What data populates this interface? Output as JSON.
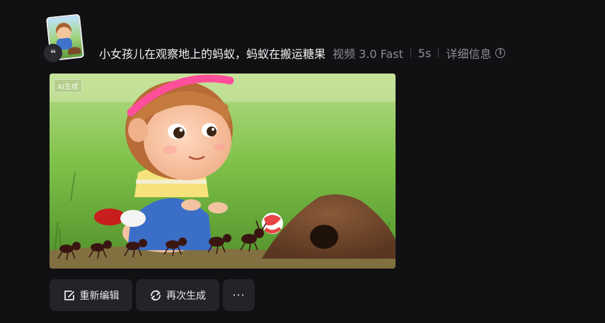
{
  "generation": {
    "prompt": "小女孩儿在观察地上的蚂蚁，蚂蚁在搬运糖果",
    "model": "视频 3.0 Fast",
    "duration": "5s",
    "details_label": "详细信息"
  },
  "video": {
    "ai_badge": "AI生成"
  },
  "actions": {
    "edit_label": "重新编辑",
    "regenerate_label": "再次生成",
    "more_label": "···"
  },
  "icons": {
    "quote": "quote-icon",
    "info": "info-icon",
    "edit": "edit-icon",
    "regenerate": "refresh-icon",
    "more": "more-icon"
  },
  "colors": {
    "background": "#111114",
    "button_bg": "#23242a",
    "meta_text": "#8d8e94"
  }
}
